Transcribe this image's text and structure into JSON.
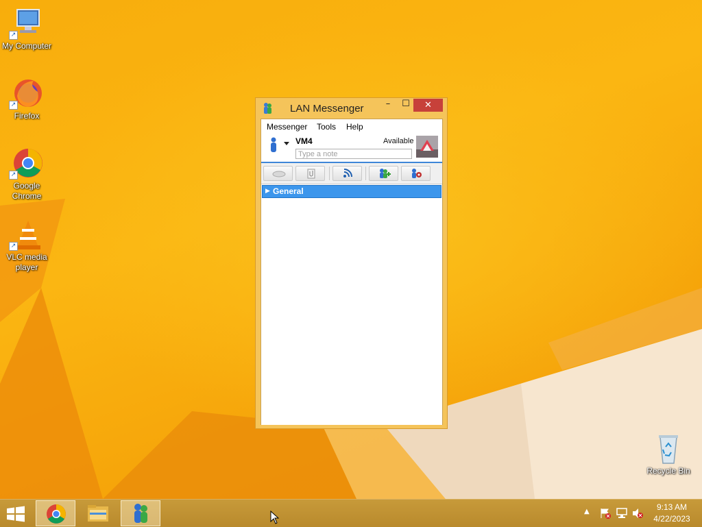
{
  "desktop": {
    "icons": [
      {
        "label": "My Computer",
        "icon": "computer-icon"
      },
      {
        "label": "Firefox",
        "icon": "firefox-icon"
      },
      {
        "label": "Google Chrome",
        "icon": "chrome-icon"
      },
      {
        "label": "VLC media player",
        "icon": "vlc-icon"
      },
      {
        "label": "Recycle Bin",
        "icon": "recycle-bin-icon"
      }
    ]
  },
  "window": {
    "title": "LAN Messenger",
    "controls": {
      "minimize": "–",
      "maximize": "☐",
      "close": "✕"
    },
    "menu": [
      "Messenger",
      "Tools",
      "Help"
    ],
    "profile": {
      "name": "VM4",
      "status": "Available",
      "note_placeholder": "Type a note"
    },
    "toolbar": [
      "chat-icon",
      "send-file-icon",
      "broadcast-icon",
      "add-contact-icon",
      "settings-icon"
    ],
    "groups": [
      {
        "label": "General",
        "expanded": false
      }
    ]
  },
  "taskbar": {
    "apps": [
      "chrome-icon",
      "file-explorer-icon",
      "lan-messenger-icon"
    ],
    "clock": {
      "time": "9:13 AM",
      "date": "4/22/2023"
    }
  },
  "colors": {
    "accent": "#3c96ec",
    "close": "#c7413a",
    "desktop": "#f8ad0c"
  }
}
